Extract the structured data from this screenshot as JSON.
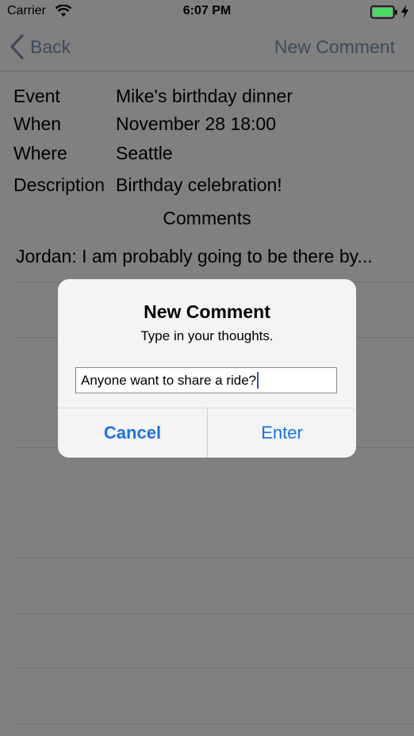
{
  "status_bar": {
    "carrier": "Carrier",
    "time": "6:07 PM",
    "wifi_icon": "wifi-icon",
    "battery_icon": "battery-charging-icon"
  },
  "nav": {
    "back_label": "Back",
    "title": "New Comment"
  },
  "details": {
    "event_label": "Event",
    "event_value": "Mike's birthday dinner",
    "when_label": "When",
    "when_value": "November 28 18:00",
    "where_label": "Where",
    "where_value": "Seattle",
    "description_label": "Description",
    "description_value": "Birthday celebration!"
  },
  "comments": {
    "heading": "Comments",
    "items": [
      "Jordan: I am probably going to be there by..."
    ]
  },
  "alert": {
    "title": "New Comment",
    "message": "Type in your thoughts.",
    "input_value": "Anyone want to share a ride?",
    "cancel_label": "Cancel",
    "enter_label": "Enter"
  },
  "colors": {
    "overlay_background": "#808080",
    "alert_background": "#f4f4f4",
    "button_blue": "#1a73e8",
    "battery_green": "#4cd964",
    "caret": "#3a4bd8"
  }
}
